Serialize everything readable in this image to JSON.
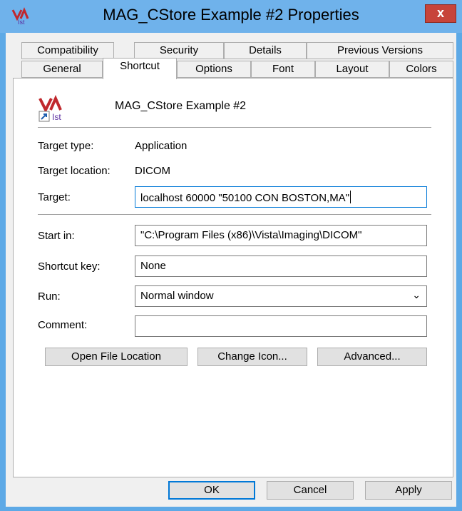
{
  "window": {
    "title": "MAG_CStore Example #2 Properties",
    "close_glyph": "x"
  },
  "tabs_row1": [
    "Compatibility",
    "Security",
    "Details",
    "Previous Versions"
  ],
  "tabs_row2": [
    "General",
    "Shortcut",
    "Options",
    "Font",
    "Layout",
    "Colors"
  ],
  "active_tab": "Shortcut",
  "shortcut": {
    "name": "MAG_CStore Example #2",
    "target_type_label": "Target type:",
    "target_type_value": "Application",
    "target_location_label": "Target location:",
    "target_location_value": "DICOM",
    "target_label": "Target:",
    "target_value": "localhost 60000 \"50100 CON BOSTON,MA\"",
    "start_in_label": "Start in:",
    "start_in_value": "\"C:\\Program Files (x86)\\Vista\\Imaging\\DICOM\"",
    "shortcut_key_label": "Shortcut key:",
    "shortcut_key_value": "None",
    "run_label": "Run:",
    "run_value": "Normal window",
    "comment_label": "Comment:",
    "comment_value": ""
  },
  "buttons": {
    "open_file_location": "Open File Location",
    "change_icon": "Change Icon...",
    "advanced": "Advanced...",
    "ok": "OK",
    "cancel": "Cancel",
    "apply": "Apply"
  },
  "colors": {
    "titlebar": "#6fb2eb",
    "close": "#c7443a",
    "focus": "#0078d7"
  },
  "icons": [
    "app-icon",
    "shortcut-arrow-icon",
    "chevron-down-icon",
    "close-icon"
  ]
}
